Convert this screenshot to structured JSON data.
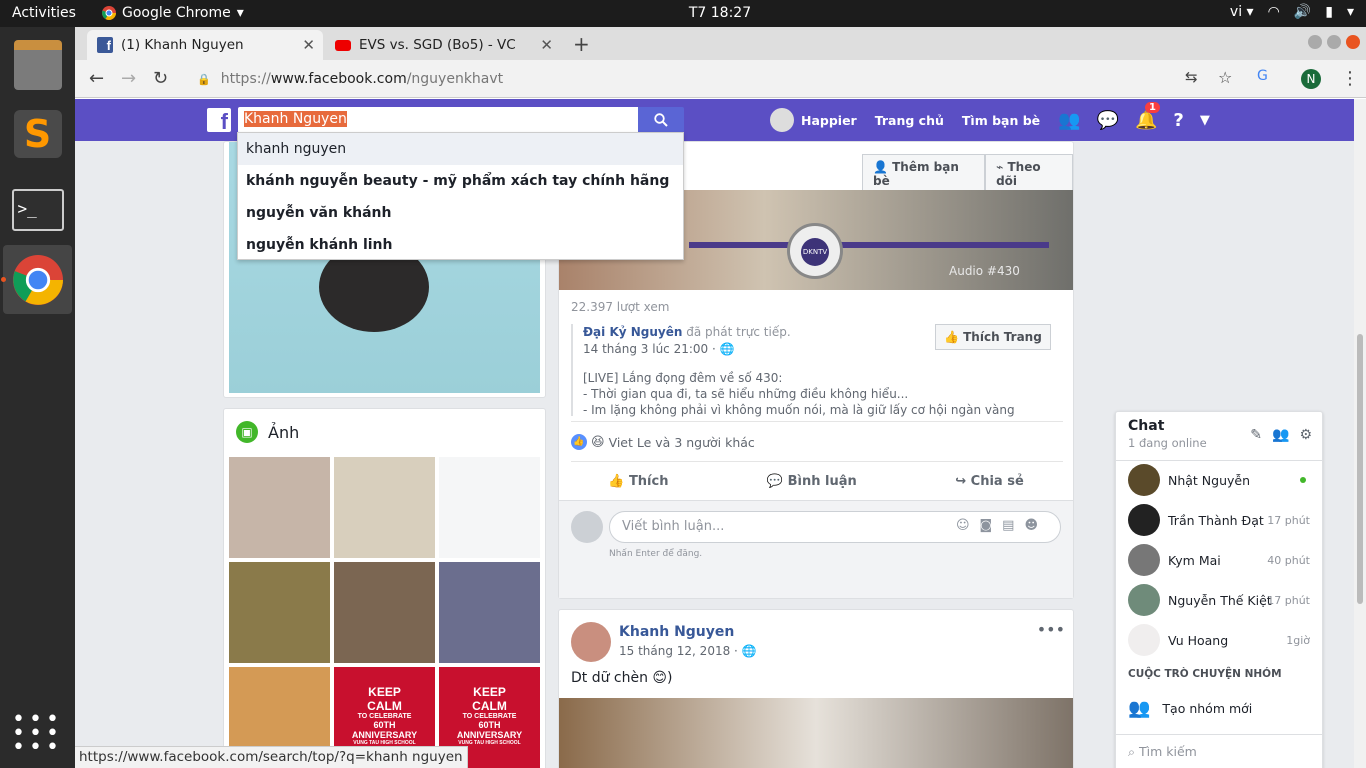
{
  "topbar": {
    "activities": "Activities",
    "app": "Google Chrome",
    "clock": "T7 18:27",
    "lang": "vi"
  },
  "tabs": [
    {
      "title": "(1) Khanh Nguyen",
      "icon": "facebook-icon"
    },
    {
      "title": "EVS vs. SGD (Bo5) - VC",
      "icon": "youtube-icon"
    }
  ],
  "url": {
    "scheme": "https://",
    "host": "www.facebook.com",
    "path": "/nguyenkhavt"
  },
  "profile_avatar_letter": "N",
  "fb": {
    "search_value": "Khanh Nguyen",
    "suggestions": [
      "khanh nguyen",
      "khánh nguyễn beauty - mỹ phẩm xách tay chính hãng",
      "nguyễn văn khánh",
      "nguyễn khánh linh"
    ],
    "nav": {
      "user": "Happier",
      "home": "Trang chủ",
      "find_friends": "Tìm bạn bè",
      "notif_count": "1"
    }
  },
  "photos_card": {
    "title": "Ảnh",
    "keep_calm": [
      "KEEP",
      "CALM",
      "TO CELEBRATE",
      "60TH",
      "ANNIVERSARY",
      "VUNG TAU HIGH SCHOOL"
    ]
  },
  "post1": {
    "add_friend": "Thêm bạn bè",
    "follow": "Theo dõi",
    "views": "22.397 lượt xem",
    "page": "Đại Kỷ Nguyên",
    "live_text": "đã phát trực tiếp.",
    "date": "14 tháng 3 lúc 21:00 ·",
    "like_page": "Thích Trang",
    "lines": [
      "[LIVE] Lắng đọng đêm về số 430:",
      "- Thời gian qua đi, ta sẽ hiểu những điều không hiểu...",
      "- Im lặng không phải vì không muốn nói, mà là giữ lấy cơ hội ngàn vàng"
    ],
    "reactions": "Viet Le và 3 người khác",
    "actions": {
      "like": "Thích",
      "comment": "Bình luận",
      "share": "Chia sẻ"
    },
    "comment_placeholder": "Viết bình luận...",
    "enter_hint": "Nhấn Enter để đăng.",
    "audio_label": "Audio #430",
    "dkn": "DKN",
    "dkn_sub": "TV"
  },
  "post2": {
    "author": "Khanh Nguyen",
    "date": "15 tháng 12, 2018 ·",
    "text": "Dt dữ chèn 😊)"
  },
  "chat": {
    "title": "Chat",
    "online": "1 đang online",
    "contacts": [
      {
        "name": "Nhật Nguyễn",
        "time": ""
      },
      {
        "name": "Trần Thành Đạt",
        "time": "17 phút"
      },
      {
        "name": "Kym Mai",
        "time": "40 phút"
      },
      {
        "name": "Nguyễn Thế Kiệt",
        "time": "17 phút"
      },
      {
        "name": "Vu Hoang",
        "time": "1giờ"
      }
    ],
    "group_header": "CUỘC TRÒ CHUYỆN NHÓM",
    "new_group": "Tạo nhóm mới",
    "search": "Tìm kiếm"
  },
  "status_url": "https://www.facebook.com/search/top/?q=khanh nguyen",
  "colors": {
    "fb_bar": "#5b4fc4",
    "link": "#385898",
    "keep_calm_red": "#c8102e"
  }
}
